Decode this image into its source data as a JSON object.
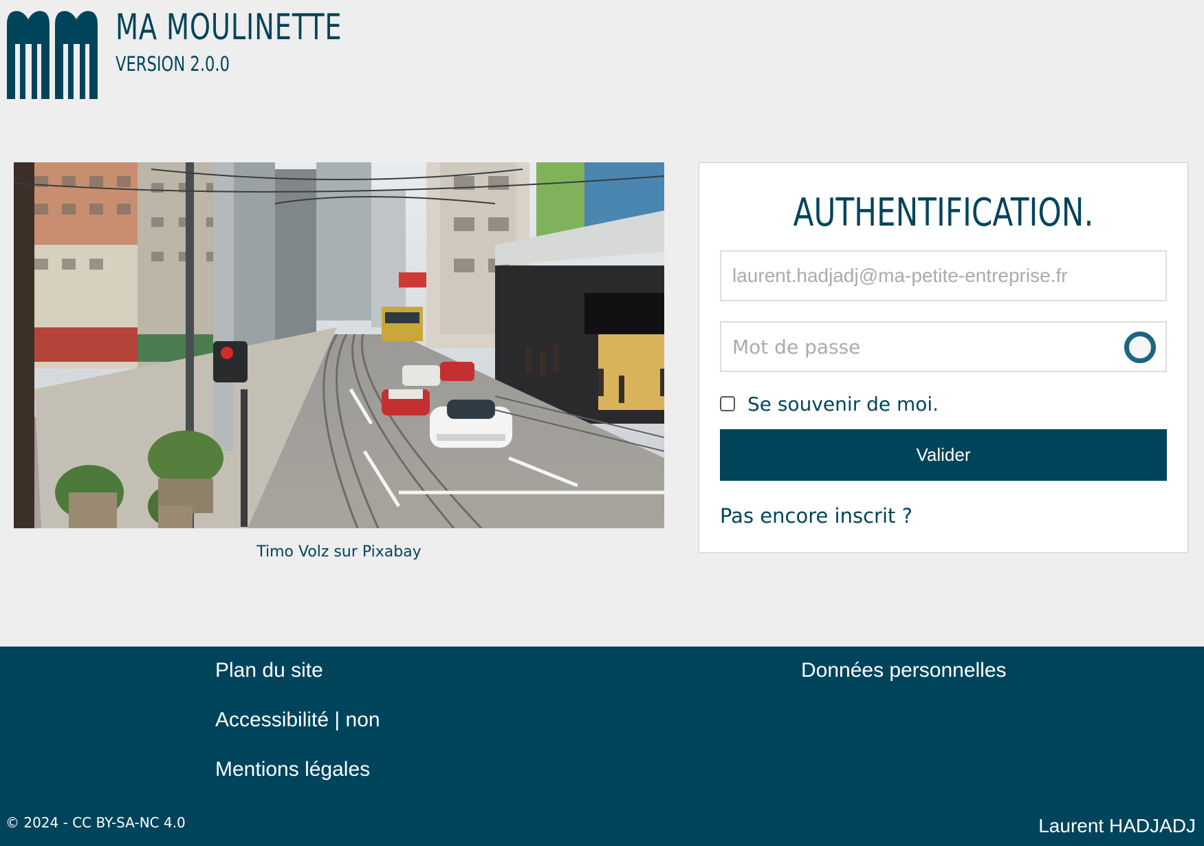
{
  "header": {
    "app_title": "MA MOULINETTE",
    "app_version": "VERSION 2.0.0",
    "logo_icon": "mm-logo-icon"
  },
  "photo": {
    "caption": "Timo Volz sur Pixabay"
  },
  "login": {
    "title": "AUTHENTIFICATION.",
    "email_placeholder": "laurent.hadjadj@ma-petite-entreprise.fr",
    "password_placeholder": "Mot de passe",
    "password_toggle_icon": "eye-toggle-icon",
    "remember_label": "Se souvenir de moi.",
    "remember_checked": false,
    "submit_label": "Valider",
    "register_link": "Pas encore inscrit ?"
  },
  "footer": {
    "plan_du_site": "Plan du site",
    "accessibilite": "Accessibilité | non",
    "mentions_legales": "Mentions légales",
    "donnees_personnelles": "Données personnelles",
    "copyright": "© 2024 - CC BY-SA-NC 4.0",
    "author": "Laurent HADJADJ"
  },
  "colors": {
    "brand": "#00445c",
    "background": "#eeeeee",
    "card": "#ffffff"
  }
}
